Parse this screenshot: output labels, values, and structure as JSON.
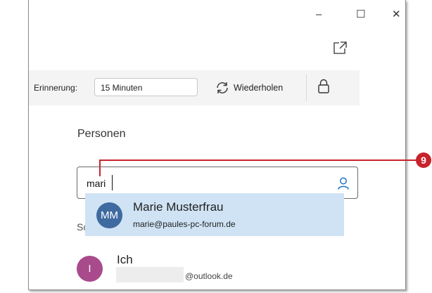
{
  "window": {
    "minimize_glyph": "–",
    "maximize_glyph": "☐",
    "close_glyph": "✕",
    "popout_icon": "popout-icon"
  },
  "toolbar": {
    "reminder_label": "Erinnerung:",
    "reminder_value": "15 Minuten",
    "repeat_label": "Wiederholen",
    "repeat_icon": "repeat-icon",
    "lock_icon": "lock-icon"
  },
  "people": {
    "section_title": "Personen",
    "input_value": "mari",
    "person_icon": "person-icon",
    "suggestion": {
      "initials": "MM",
      "name": "Marie Musterfrau",
      "email": "marie@paules-pc-forum.de",
      "avatar_color": "#3f6aa0",
      "highlight_color": "#cfe3f4"
    },
    "hidden_label_fragment": "Sc",
    "me": {
      "initial": "I",
      "name": "Ich",
      "email_domain": "@outlook.de",
      "avatar_color": "#a84a8c"
    }
  },
  "callout": {
    "number": "9",
    "color": "#c8232c"
  }
}
